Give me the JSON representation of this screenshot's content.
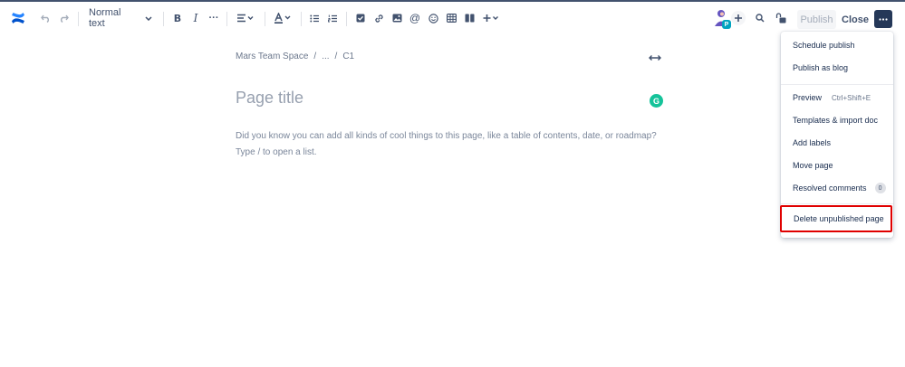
{
  "toolbar": {
    "text_style": "Normal text",
    "icons": [
      "confluence-logo-icon",
      "undo-icon",
      "redo-icon",
      "bold-icon",
      "italic-icon",
      "more-formatting-icon",
      "align-icon",
      "text-color-icon",
      "bullet-list-icon",
      "numbered-list-icon",
      "action-item-icon",
      "link-icon",
      "image-icon",
      "mention-icon",
      "emoji-icon",
      "table-icon",
      "layouts-icon",
      "insert-icon"
    ]
  },
  "header": {
    "avatar_badge": "P",
    "publish_label": "Publish",
    "close_label": "Close"
  },
  "breadcrumb": {
    "space": "Mars Team Space",
    "sep1": "/",
    "ellipsis": "...",
    "sep2": "/",
    "page": "C1"
  },
  "editor": {
    "title_placeholder": "Page title",
    "body_line1": "Did you know you can add all kinds of cool things to this page, like a table of contents, date, or roadmap?",
    "body_line2": "Type / to open a list.",
    "grammarly_letter": "G"
  },
  "menu": {
    "items": [
      {
        "label": "Schedule publish"
      },
      {
        "label": "Publish as blog"
      },
      {
        "label": "Preview",
        "shortcut": "Ctrl+Shift+E"
      },
      {
        "label": "Templates & import doc"
      },
      {
        "label": "Add labels"
      },
      {
        "label": "Move page"
      },
      {
        "label": "Resolved comments",
        "badge": "0"
      },
      {
        "label": "Delete unpublished page"
      }
    ]
  },
  "colors": {
    "accent": "#0052CC",
    "highlight_border": "#E00000",
    "grammarly": "#15C39A",
    "more_button": "#253858"
  }
}
